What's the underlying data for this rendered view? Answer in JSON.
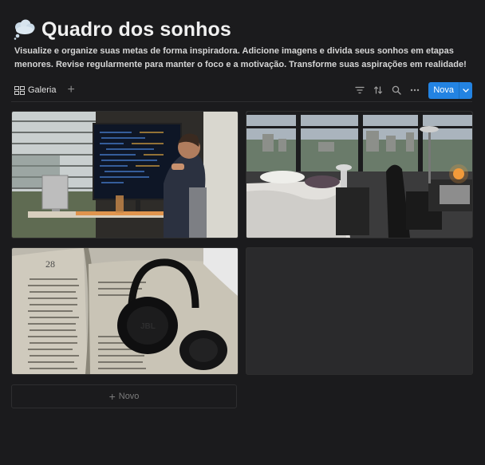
{
  "page": {
    "icon": "thought-balloon-icon",
    "title": "Quadro dos sonhos",
    "description": "Visualize e organize suas metas de forma inspiradora. Adicione imagens e divida seus sonhos em etapas menores. Revise regularmente para manter o foco e a motivação. Transforme suas aspirações em realidade!"
  },
  "toolbar": {
    "view_label": "Galeria",
    "view_icon": "gallery-grid-icon",
    "add_view": "+",
    "icons": [
      "filter-icon",
      "sort-icon",
      "search-icon",
      "more-icon"
    ],
    "new_label": "Nova",
    "new_dropdown_icon": "chevron-down-icon",
    "accent": "#2383e2"
  },
  "gallery": {
    "cards": [
      {
        "image": "desk-workspace-photo"
      },
      {
        "image": "bedroom-city-view-photo"
      },
      {
        "image": "book-headphones-photo"
      },
      {
        "image": "empty"
      }
    ],
    "new_item_label": "Novo"
  }
}
